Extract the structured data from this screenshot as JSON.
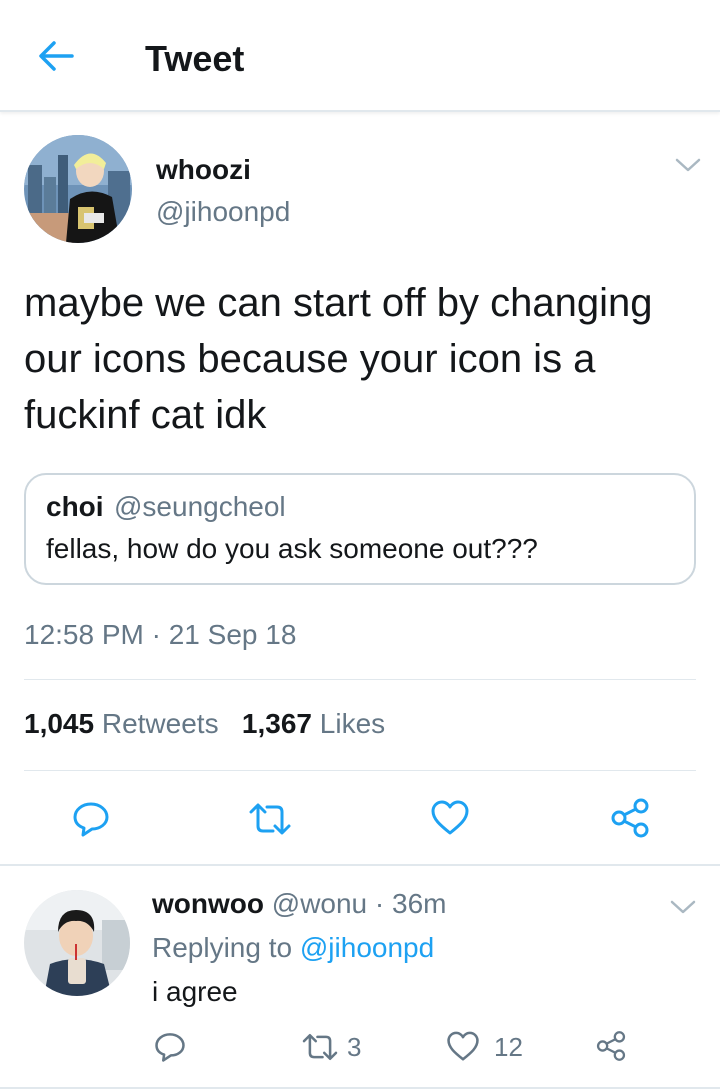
{
  "header": {
    "title": "Tweet"
  },
  "tweet": {
    "display_name": "whoozi",
    "handle": "@jihoonpd",
    "text": "maybe we can start off by changing our icons because your icon is a fuckinf cat idk",
    "quote": {
      "name": "choi",
      "handle": "@seungcheol",
      "text": "fellas, how do you ask someone out???"
    },
    "timestamp": "12:58 PM · 21 Sep 18",
    "retweets_count": "1,045",
    "retweets_label": "Retweets",
    "likes_count": "1,367",
    "likes_label": "Likes"
  },
  "reply": {
    "display_name": "wonwoo",
    "meta": "@wonu · 36m",
    "replying_prefix": "Replying to",
    "replying_handle": "@jihoonpd",
    "text": "i agree",
    "retweet_count": "3",
    "like_count": "12"
  },
  "icons": {
    "back": "arrow-left-icon",
    "chevron": "chevron-down-icon",
    "reply": "reply-icon",
    "retweet": "retweet-icon",
    "like": "heart-icon",
    "share": "share-icon"
  },
  "colors": {
    "accent": "#1da1f2",
    "text": "#14171a",
    "secondary": "#657786",
    "border": "#e1e8ed"
  }
}
